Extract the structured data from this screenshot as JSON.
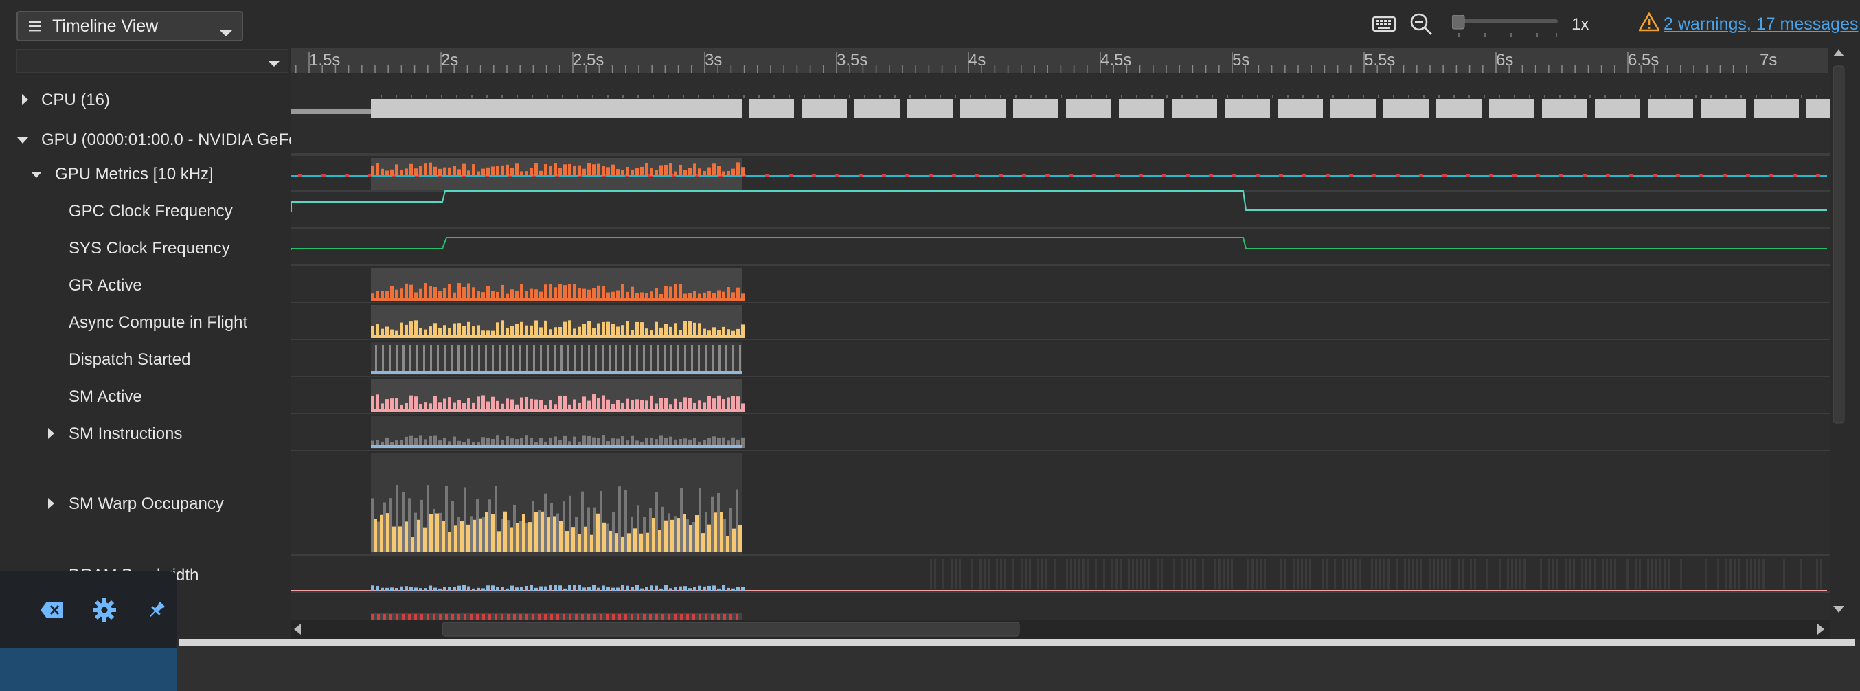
{
  "toolbar": {
    "view_name": "Timeline View",
    "zoom_level": "1x",
    "warnings_link": "2 warnings, 17 messages",
    "icons": [
      "hamburger-icon",
      "chevron-down-icon",
      "keyboard-icon",
      "zoom-out-icon",
      "warning-icon"
    ]
  },
  "ruler": {
    "ticks": [
      "1.5s",
      "2s",
      "2.5s",
      "3s",
      "3.5s",
      "4s",
      "4.5s",
      "5s",
      "5.5s",
      "6s",
      "6.5s",
      "7s"
    ]
  },
  "tree": {
    "cpu": "CPU (16)",
    "gpu": "GPU (0000:01:00.0 - NVIDIA GeFor",
    "gpu_metrics": "GPU Metrics [10 kHz]",
    "gpc_clock": "GPC Clock Frequency",
    "sys_clock": "SYS Clock Frequency",
    "gr_active": "GR Active",
    "async_compute": "Async Compute in Flight",
    "dispatch_started": "Dispatch Started",
    "sm_active": "SM Active",
    "sm_instructions": "SM Instructions",
    "sm_warp_occupancy": "SM Warp Occupancy",
    "dram_bandwidth": "DRAM Bandwidth"
  },
  "colors": {
    "orange": "#f0703a",
    "yellow": "#f7c872",
    "pink": "#f4a3a8",
    "blue": "#8fb8dc",
    "teal": "#55d6c0",
    "green": "#27c06a",
    "cpu_gray": "#c9c9c9"
  }
}
